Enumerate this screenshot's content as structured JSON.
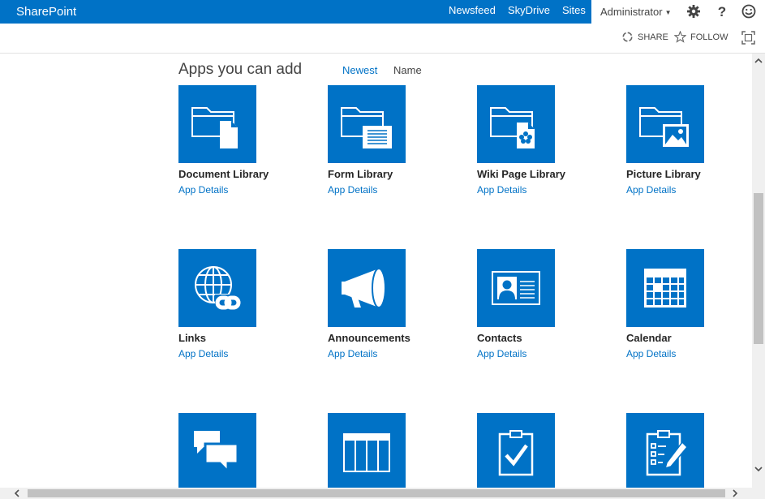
{
  "suite_bar": {
    "brand": "SharePoint",
    "nav": [
      "Newsfeed",
      "SkyDrive",
      "Sites"
    ],
    "user": "Administrator",
    "icons": [
      "gear-icon",
      "help-icon",
      "smiley-icon"
    ]
  },
  "ribbon": {
    "share": "SHARE",
    "follow": "FOLLOW"
  },
  "main": {
    "heading": "Apps you can add",
    "sort_newest": "Newest",
    "sort_name": "Name",
    "apps": [
      {
        "title": "Document Library",
        "link": "App Details",
        "icon": "document-library-icon"
      },
      {
        "title": "Form Library",
        "link": "App Details",
        "icon": "form-library-icon"
      },
      {
        "title": "Wiki Page Library",
        "link": "App Details",
        "icon": "wiki-page-library-icon"
      },
      {
        "title": "Picture Library",
        "link": "App Details",
        "icon": "picture-library-icon"
      },
      {
        "title": "Links",
        "link": "App Details",
        "icon": "links-icon"
      },
      {
        "title": "Announcements",
        "link": "App Details",
        "icon": "announcements-icon"
      },
      {
        "title": "Contacts",
        "link": "App Details",
        "icon": "contacts-icon"
      },
      {
        "title": "Calendar",
        "link": "App Details",
        "icon": "calendar-icon"
      },
      {
        "title": "",
        "link": "",
        "icon": "discussion-board-icon"
      },
      {
        "title": "",
        "link": "",
        "icon": "custom-list-icon"
      },
      {
        "title": "",
        "link": "",
        "icon": "tasks-icon"
      },
      {
        "title": "",
        "link": "",
        "icon": "issue-tracking-icon"
      }
    ]
  },
  "colors": {
    "brand_blue": "#0072c6",
    "tile_text": "#262626",
    "muted_text": "#444444"
  }
}
